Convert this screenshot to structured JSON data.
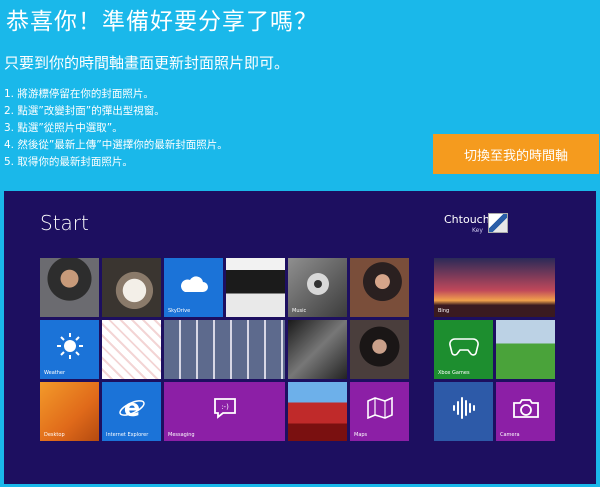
{
  "header": {
    "title": "恭喜你！準備好要分享了嗎？",
    "subtitle": "只要到你的時間軸畫面更新封面照片即可。"
  },
  "steps": [
    "1. 將游標停留在你的封面照片。",
    "2. 點選”改變封面”的彈出型視窗。",
    "3. 點選”從照片中選取”。",
    "4. 然後從”最新上傳”中選擇你的最新封面照片。",
    "5. 取得你的最新封面照片。"
  ],
  "cta_label": "切換至我的時間軸",
  "start_screen": {
    "heading": "Start",
    "user_name": "Chtouch",
    "user_sub": "Key",
    "tiles": {
      "skydrive": "SkyDrive",
      "music": "Music",
      "bing": "Bing",
      "weather": "Weather",
      "xbox": "Xbox Games",
      "desktop": "Desktop",
      "ie": "Internet Explorer",
      "messaging": "Messaging",
      "maps": "Maps",
      "camera": "Camera"
    }
  },
  "colors": {
    "background": "#1ab8ea",
    "cta": "#f59b1e",
    "start_bg": "#1d0f60",
    "tile_blue": "#1b73d8",
    "tile_purple": "#8c1fa6",
    "tile_green": "#1d8e2f",
    "tile_violet": "#5634b2",
    "tile_steelblue": "#2d5aa8"
  }
}
